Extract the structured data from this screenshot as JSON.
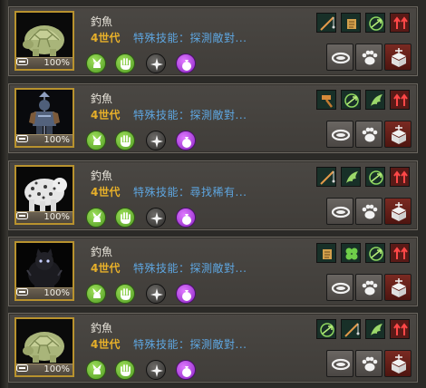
{
  "pets": [
    {
      "id": "turtle",
      "name": "釣魚",
      "generation": "4世代",
      "skill": "特殊技能：探測敵對...",
      "health_pct": "100%",
      "skills": [
        "rod",
        "scroll",
        "paw-arrow",
        "red-arrows"
      ]
    },
    {
      "id": "knight",
      "name": "釣魚",
      "generation": "4世代",
      "skill": "特殊技能：探測敵對...",
      "health_pct": "100%",
      "skills": [
        "hammer",
        "paw-arrow",
        "wing",
        "red-arrows"
      ]
    },
    {
      "id": "leopard",
      "name": "釣魚",
      "generation": "4世代",
      "skill": "特殊技能：尋找稀有...",
      "health_pct": "100%",
      "skills": [
        "rod",
        "wing",
        "paw-arrow",
        "red-arrows"
      ]
    },
    {
      "id": "cat",
      "name": "釣魚",
      "generation": "4世代",
      "skill": "特殊技能：探測敵對...",
      "health_pct": "100%",
      "skills": [
        "scroll",
        "clover",
        "paw-arrow",
        "red-arrows"
      ]
    },
    {
      "id": "turtle",
      "name": "釣魚",
      "generation": "4世代",
      "skill": "特殊技能：探測敵對...",
      "health_pct": "100%",
      "skills": [
        "paw-arrow",
        "rod",
        "wing",
        "red-arrows"
      ]
    }
  ],
  "action_icons": [
    "feed-bowl-icon",
    "paw-icon",
    "seal-box-icon"
  ],
  "colors": {
    "gold": "#e7b02a",
    "skill_blue": "#5ea6e0",
    "frame_gold": "#b8922e"
  }
}
